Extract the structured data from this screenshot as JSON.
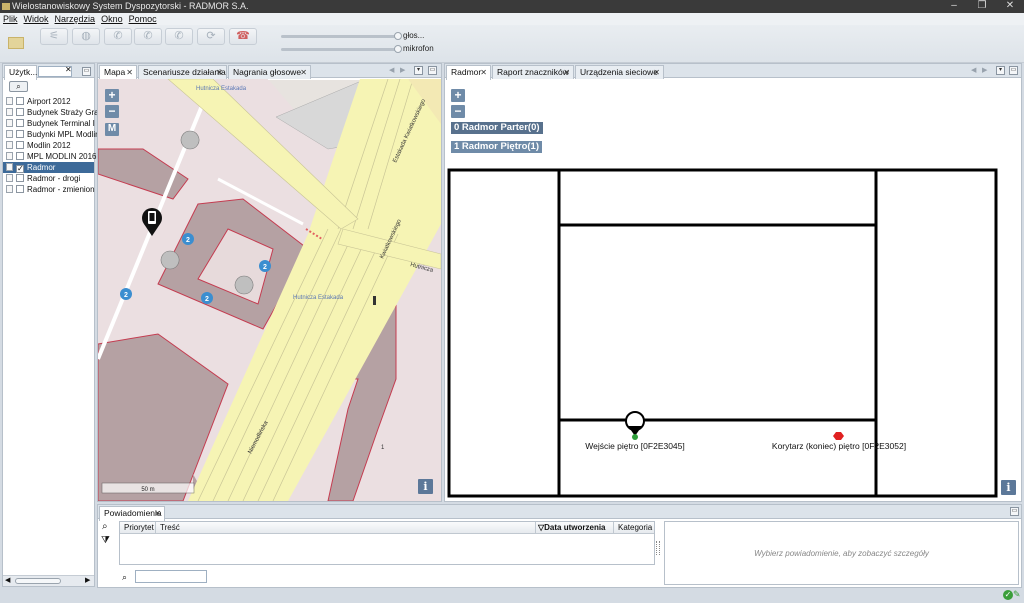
{
  "window": {
    "title": "Wielostanowiskowy System Dyspozytorski - RADMOR S.A.",
    "controls": [
      "–",
      "❐",
      "✕"
    ]
  },
  "menu": [
    "Plik",
    "Widok",
    "Narzędzia",
    "Okno",
    "Pomoc"
  ],
  "toolbar": {
    "audio": {
      "voice_label": "głos...",
      "mic_label": "mikrofon",
      "voice_level": 0.9,
      "mic_level": 0.9
    }
  },
  "left_panel": {
    "tab_label": "Użytk...",
    "items": [
      {
        "label": "Airport 2012",
        "checked": false,
        "selected": false
      },
      {
        "label": "Budynek Straży Gra",
        "checked": false,
        "selected": false
      },
      {
        "label": "Budynek Terminal I",
        "checked": false,
        "selected": false
      },
      {
        "label": "Budynki MPL Modlin",
        "checked": false,
        "selected": false
      },
      {
        "label": "Modlin 2012",
        "checked": false,
        "selected": false
      },
      {
        "label": "MPL MODLIN 2016",
        "checked": false,
        "selected": false
      },
      {
        "label": "Radmor",
        "checked": true,
        "selected": true
      },
      {
        "label": "Radmor - drogi",
        "checked": false,
        "selected": false
      },
      {
        "label": "Radmor - zmienion",
        "checked": false,
        "selected": false
      }
    ]
  },
  "map_panel": {
    "tabs": [
      {
        "label": "Mapa",
        "active": true
      },
      {
        "label": "Scenariusze działania",
        "active": false
      },
      {
        "label": "Nagrania głosowe",
        "active": false
      }
    ],
    "zoom_in": "+",
    "zoom_out": "−",
    "mode_button": "M",
    "scale_label": "50 m",
    "info_button": "i",
    "street_labels": [
      "Hutnicza Estakada",
      "Estakada Kwiatkowskiego",
      "Kwiatkowskiego",
      "Hutnicza",
      "Niemodlińska",
      "Hutnicza Estakada"
    ],
    "cluster_counts": [
      "2",
      "2",
      "2",
      "2"
    ],
    "building_number": "1"
  },
  "floor_panel": {
    "tabs": [
      {
        "label": "Radmor",
        "active": true
      },
      {
        "label": "Raport znaczników",
        "active": false
      },
      {
        "label": "Urządzenia sieciowe",
        "active": false
      }
    ],
    "zoom_in": "+",
    "zoom_out": "−",
    "floors": [
      {
        "label": "0 Radmor Parter(0)",
        "active": true
      },
      {
        "label": "1 Radmor Piętro(1)",
        "active": false
      }
    ],
    "markers": [
      {
        "label": "Wejście piętro [0F2E3045]",
        "color": "#2e9e3a"
      },
      {
        "label": "Korytarz (koniec) piętro [0F2E3052]",
        "color": "#e02020"
      }
    ],
    "info_button": "i"
  },
  "notifications": {
    "tab_label": "Powiadomienia",
    "columns": [
      "Priorytet",
      "Treść",
      "Data utworzenia",
      "Kategoria"
    ],
    "sort_column": "Data utworzenia",
    "detail_placeholder": "Wybierz powiadomienie, aby zobaczyć szczegóły"
  },
  "colors": {
    "accent": "#6f8ba8",
    "selection": "#3d6a99",
    "map_building": "#b5a1a3",
    "map_road": "#f6f4b4"
  }
}
